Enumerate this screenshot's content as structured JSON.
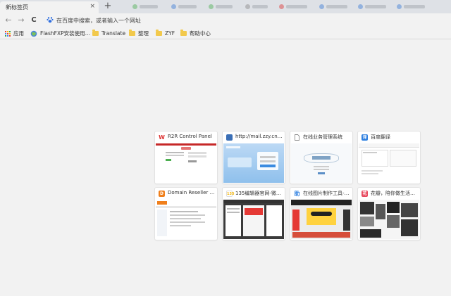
{
  "tabs": {
    "active_title": "新标签页",
    "close_symbol": "×",
    "new_tab_symbol": "+"
  },
  "toolbar": {
    "back_symbol": "←",
    "forward_symbol": "→",
    "reload_symbol": "C",
    "omnibox_placeholder": "在百度中搜索，或者输入一个网址"
  },
  "bookmarks": [
    {
      "label": "应用",
      "icon": "apps-icon"
    },
    {
      "label": "FlashFXP安装使用…",
      "icon": "globe-icon"
    },
    {
      "label": "Translate",
      "icon": "folder-icon"
    },
    {
      "label": "整理",
      "icon": "folder-icon"
    },
    {
      "label": "ZYF",
      "icon": "folder-icon"
    },
    {
      "label": "帮助中心",
      "icon": "folder-icon"
    }
  ],
  "most_visited": [
    {
      "title": "R2R Control Panel",
      "favicon": "W",
      "favicon_color": "#d33"
    },
    {
      "title": "http://mail.zzy.cn/we…",
      "favicon": "",
      "favicon_color": "#3b6fb6"
    },
    {
      "title": "在线业务管理系统",
      "favicon": "",
      "favicon_color": "#ffffff"
    },
    {
      "title": "百度翻译",
      "favicon": "译",
      "favicon_color": "#2d7fe0"
    },
    {
      "title": "Domain Reseller Pr…",
      "favicon": "D",
      "favicon_color": "#f07f1b"
    },
    {
      "title": "135编辑器官网-微…",
      "favicon": "135",
      "favicon_color": "#ffffff"
    },
    {
      "title": "在线图片制作工具-…",
      "favicon": "助",
      "favicon_color": "#ffffff"
    },
    {
      "title": "花瓣，陪你做生活的…",
      "favicon": "花",
      "favicon_color": "#e84a5f"
    }
  ]
}
